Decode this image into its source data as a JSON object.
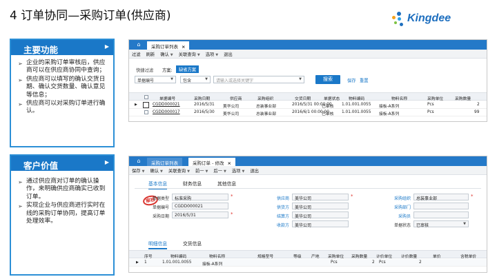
{
  "slide": {
    "title": "4 订单协同—采购订单(供应商)",
    "logo_text": "Kingdee"
  },
  "main_functions": {
    "header": "主要功能",
    "items": [
      "企业的采购订单审核后，供应商可以在供应商协同中查询；",
      "供应商可以填写的确认交货日期、确认交货数量、确认意见等信息；",
      "供应商可以对采购订单进行确认。"
    ]
  },
  "customer_value": {
    "header": "客户价值",
    "items": [
      "通过供应商对订单的确认操作，来明确供应商确实已收到订单。",
      "实现企业与供应商进行实时在线的采购订单协同，提高订单处理效率。"
    ]
  },
  "list_window": {
    "tab_label": "采购订单列表",
    "toolbar": [
      "过滤",
      "刷新",
      "确认",
      "关联查询",
      "选项",
      "退出"
    ],
    "quick_filter_label": "快捷过滤",
    "scheme_label": "方案:",
    "scheme_value": "缺省方案",
    "field_select": "单据编号",
    "op_select": "包含",
    "search_placeholder": "请输入或选择关键字",
    "search_button": "搜索",
    "save_link": "保存",
    "reset_link": "重置",
    "columns": [
      "单据编号",
      "采购日期",
      "供应商",
      "采购组织",
      "交货日期",
      "单据状态",
      "物料编码",
      "物料名称",
      "采购单位",
      "采购数量"
    ],
    "rows": [
      [
        "CGDD000021",
        "2016/5/31",
        "美华公司",
        "总装事业部",
        "2016/5/31 00:00:00",
        "已审核",
        "1.01.001.0055",
        "接板-A系列",
        "Pcs",
        "2"
      ],
      [
        "CGDD000017",
        "2016/5/30",
        "美华公司",
        "总装事业部",
        "2016/6/1 00:00:00",
        "已审核",
        "1.01.001.0055",
        "接板-A系列",
        "Pcs",
        "99"
      ]
    ]
  },
  "edit_window": {
    "tab_label": "采购订单 - 修改",
    "toolbar": [
      "保存",
      "确认",
      "关联查询",
      "前一",
      "后一",
      "选项",
      "退出"
    ],
    "subtabs": [
      "基本信息",
      "财务信息",
      "其他信息"
    ],
    "stamp_text": "审核",
    "left_fields": [
      {
        "label": "单据类型",
        "value": "标准采购"
      },
      {
        "label": "单据编号",
        "value": "CGDD000021"
      },
      {
        "label": "采购日期",
        "value": "2016/5/31"
      }
    ],
    "mid_fields": [
      {
        "label": "供应商",
        "value": "美华公司"
      },
      {
        "label": "供货方",
        "value": "美华公司"
      },
      {
        "label": "结算方",
        "value": "美华公司"
      },
      {
        "label": "收款方",
        "value": "美华公司"
      }
    ],
    "right_fields": [
      {
        "label": "采购组织",
        "value": "总装事业部"
      },
      {
        "label": "采购部门",
        "value": ""
      },
      {
        "label": "采购员",
        "value": ""
      },
      {
        "label": "单据状态",
        "value": "已审核"
      }
    ],
    "detail_tabs": [
      "明细信息",
      "交货信息"
    ],
    "detail_columns": [
      "序号",
      "物料编码",
      "物料名称",
      "规格型号",
      "等级",
      "产地",
      "采购单位",
      "采购数量",
      "计价单位",
      "计价数量",
      "单价",
      "含税单价"
    ],
    "detail_rows": [
      [
        "1",
        "1.01.001.0055",
        "接板-A系列",
        "",
        "",
        "",
        "Pcs",
        "2",
        "Pcs",
        "2",
        "",
        ""
      ]
    ]
  },
  "colors": {
    "accent": "#1a78c8",
    "panel_border": "#2b8fd6",
    "required": "#e0302a"
  }
}
